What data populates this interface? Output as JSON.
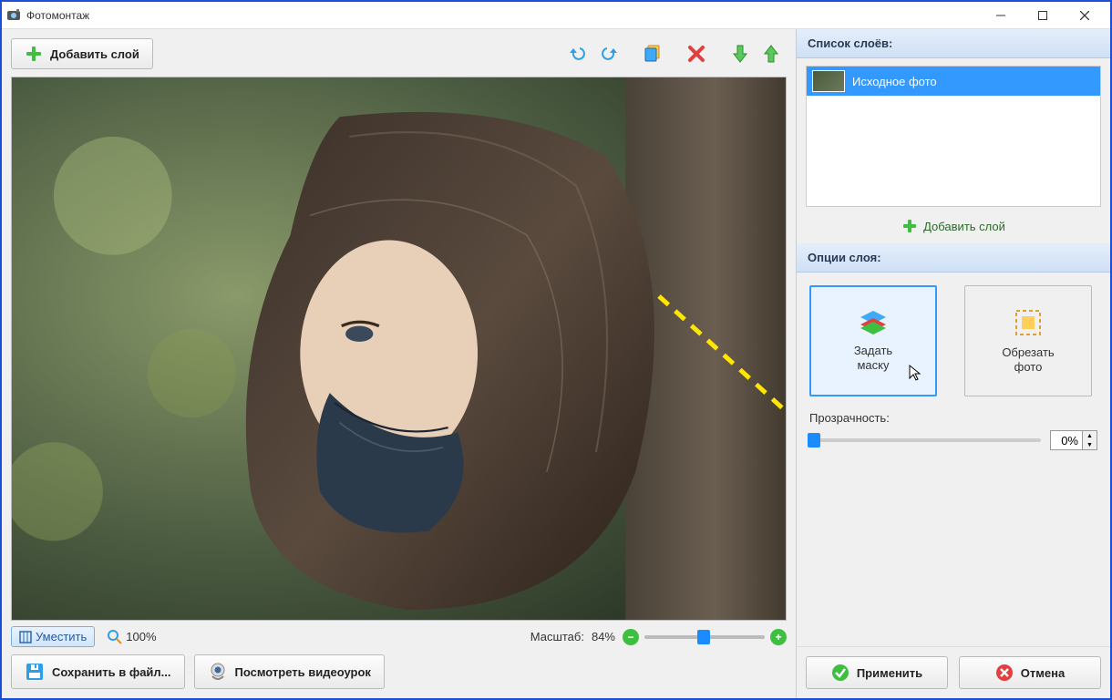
{
  "window": {
    "title": "Фотомонтаж"
  },
  "toolbar": {
    "add_layer": "Добавить слой"
  },
  "zoom": {
    "fit": "Уместить",
    "hundred": "100%",
    "label": "Масштаб:",
    "value": "84%"
  },
  "bottom": {
    "save": "Сохранить в файл...",
    "video": "Посмотреть видеоурок"
  },
  "layers": {
    "header": "Список слоёв:",
    "items": [
      {
        "label": "Исходное фото"
      }
    ],
    "add": "Добавить слой"
  },
  "options": {
    "header": "Опции слоя:",
    "mask": "Задать\nмаску",
    "crop": "Обрезать\nфото"
  },
  "opacity": {
    "label": "Прозрачность:",
    "value": "0%"
  },
  "actions": {
    "apply": "Применить",
    "cancel": "Отмена"
  }
}
